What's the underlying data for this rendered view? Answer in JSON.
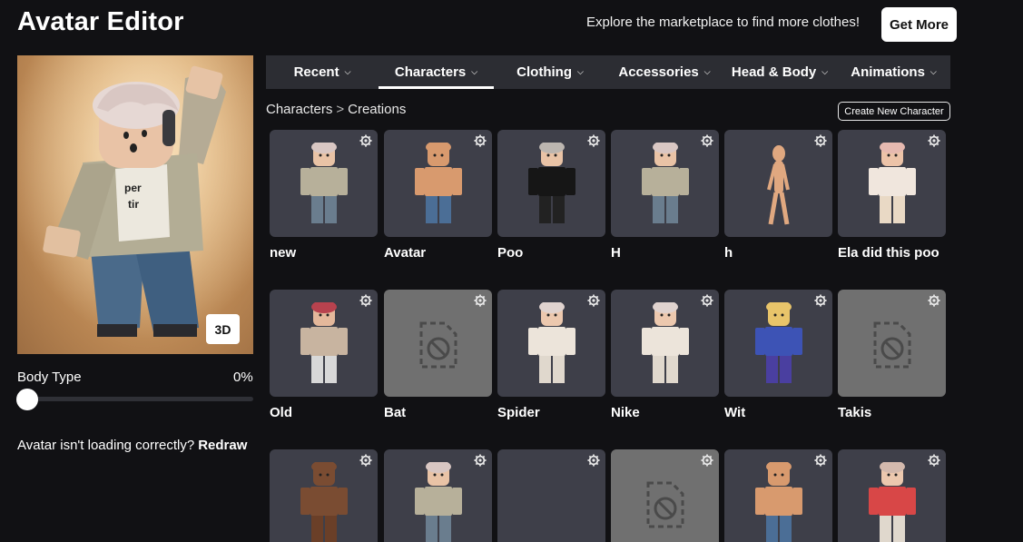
{
  "header": {
    "title": "Avatar Editor",
    "promo_text": "Explore the marketplace to find more clothes!",
    "get_more_label": "Get More"
  },
  "preview": {
    "btn_3d_label": "3D",
    "body_type_label": "Body Type",
    "body_type_value": "0%",
    "body_type_level": 0,
    "loading_note": "Avatar isn't loading correctly?",
    "redraw_label": "Redraw"
  },
  "tabs": [
    {
      "label": "Recent",
      "active": false
    },
    {
      "label": "Characters",
      "active": true
    },
    {
      "label": "Clothing",
      "active": false
    },
    {
      "label": "Accessories",
      "active": false
    },
    {
      "label": "Head & Body",
      "active": false
    },
    {
      "label": "Animations",
      "active": false
    }
  ],
  "breadcrumb": {
    "parent": "Characters",
    "separator": ">",
    "current": "Creations"
  },
  "create_new_label": "Create New Character",
  "characters": [
    {
      "name": "new",
      "thumb": "avatar-beige",
      "gear_icon": "gear-icon"
    },
    {
      "name": "Avatar",
      "thumb": "avatar-tan",
      "gear_icon": "gear-icon"
    },
    {
      "name": "Poo",
      "thumb": "avatar-black",
      "gear_icon": "gear-icon"
    },
    {
      "name": "H",
      "thumb": "avatar-beige",
      "gear_icon": "gear-icon"
    },
    {
      "name": "h",
      "thumb": "avatar-skinny",
      "gear_icon": "gear-icon"
    },
    {
      "name": "Ela did this poo",
      "thumb": "avatar-pink",
      "gear_icon": "gear-icon"
    },
    {
      "name": "Old",
      "thumb": "avatar-old",
      "gear_icon": "gear-icon"
    },
    {
      "name": "Bat",
      "thumb": "unavailable",
      "gear_icon": "gear-icon"
    },
    {
      "name": "Spider",
      "thumb": "avatar-white",
      "gear_icon": "gear-icon"
    },
    {
      "name": "Nike",
      "thumb": "avatar-white",
      "gear_icon": "gear-icon"
    },
    {
      "name": "Wit",
      "thumb": "avatar-blue",
      "gear_icon": "gear-icon"
    },
    {
      "name": "Takis",
      "thumb": "unavailable",
      "gear_icon": "gear-icon"
    },
    {
      "name": "",
      "thumb": "avatar-bear",
      "gear_icon": "gear-icon"
    },
    {
      "name": "",
      "thumb": "avatar-beige",
      "gear_icon": "gear-icon"
    },
    {
      "name": "",
      "thumb": "blank",
      "gear_icon": "gear-icon"
    },
    {
      "name": "",
      "thumb": "unavailable",
      "gear_icon": "gear-icon"
    },
    {
      "name": "",
      "thumb": "avatar-tan",
      "gear_icon": "gear-icon"
    },
    {
      "name": "",
      "thumb": "avatar-red",
      "gear_icon": "gear-icon"
    }
  ],
  "colors": {
    "background": "#111114",
    "tab_bar": "#2c2d33",
    "card": "#3e3f49",
    "card_unavailable": "#707070"
  }
}
